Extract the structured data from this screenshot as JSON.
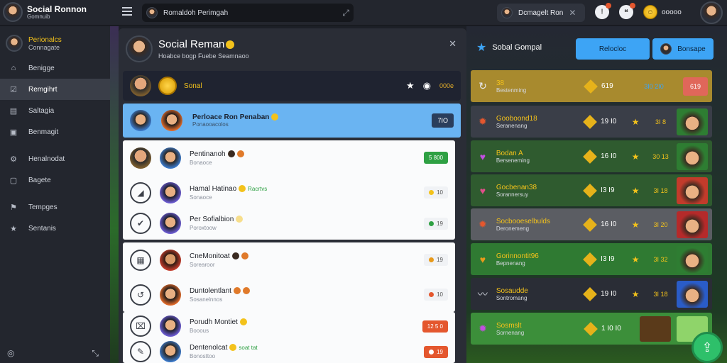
{
  "topbar": {
    "brand_title": "Social Ronnon",
    "brand_sub": "Gomnuib",
    "search_text": "Romaldoh Perimgah",
    "user_chip_name": "Dcmagelt Ron",
    "coins": "ooooo"
  },
  "sidebar": {
    "profile_name": "Perionalcs",
    "profile_sub": "Connagate",
    "items": [
      {
        "label": "Benigge",
        "icon": "home-icon"
      },
      {
        "label": "Remgihrt",
        "icon": "check-square-icon"
      },
      {
        "label": "Saltagia",
        "icon": "chart-icon"
      },
      {
        "label": "Benmagit",
        "icon": "media-icon"
      },
      {
        "label": "Henalnodat",
        "icon": "settings-icon"
      },
      {
        "label": "Bagete",
        "icon": "chat-icon"
      },
      {
        "label": "Tempges",
        "icon": "users-icon"
      },
      {
        "label": "Sentanis",
        "icon": "star-icon"
      }
    ]
  },
  "panel": {
    "title": "Social Reman",
    "subtitle": "Hoabce bogp Fuebe Seamnaoo",
    "dark_row_label": "Sonal",
    "dark_row_count": "000e",
    "highlight": {
      "name": "Perloace Ron Penaban",
      "sub": "Ponaooacolos",
      "badge": "7IO"
    },
    "entries": [
      {
        "name": "Pentinanoh",
        "sub": "Bonaoce",
        "pill": "5 800",
        "pill_style": "green"
      },
      {
        "name": "Hamal Hatinao",
        "tag": "Racrtvs",
        "sub": "Sonaoce",
        "pill": "10",
        "pill_style": "soft"
      },
      {
        "name": "Per Sofialbion",
        "sub": "Poroxtoow",
        "pill": "19",
        "pill_style": "soft"
      },
      {
        "name": "CneMonitoat",
        "sub": "Sorearoor",
        "pill": "19",
        "pill_style": "soft"
      },
      {
        "name": "Duntolentlant",
        "sub": "Sosanelnnos",
        "pill": "10",
        "pill_style": "soft"
      },
      {
        "name": "Porudh Montiet",
        "sub": "Booous",
        "pill": "12 5 0",
        "pill_style": "red"
      },
      {
        "name": "Dentenolcat",
        "tag": "soat tat",
        "sub": "Bonosttoo",
        "pill": "19",
        "pill_style": "soft"
      }
    ]
  },
  "right": {
    "heading": "Sobal Gompal",
    "btn1": "Relocloc",
    "btn2": "Bonsape",
    "rows": [
      {
        "t1": "38",
        "t2": "Bestenming",
        "num": "619",
        "ctr": "3I0 2I0",
        "right": "619",
        "bg": "#a88a2e"
      },
      {
        "t1": "Gooboond18",
        "t2": "Seranenang",
        "num": "19 I0",
        "ctr": "3I 8",
        "bg": "#3a3e48"
      },
      {
        "t1": "Bodan A",
        "t2": "Berseneming",
        "num": "16 I0",
        "ctr": "30 13",
        "bg": "#2f5b2f"
      },
      {
        "t1": "Gocbenan38",
        "t2": "Sorannersuy",
        "num": "I3 I9",
        "ctr": "3I 18",
        "bg": "#2f5b2f"
      },
      {
        "t1": "Socbooeselbulds",
        "t2": "Deronemeng",
        "num": "16 I0",
        "ctr": "3I 20",
        "bg": "#5b5d63"
      },
      {
        "t1": "Gorinnontit96",
        "t2": "Bepnenang",
        "num": "I3 I9",
        "ctr": "3I 32",
        "bg": "#2f7a32"
      },
      {
        "t1": "Sosaudde",
        "t2": "Sontromang",
        "num": "19 I0",
        "ctr": "3I 18",
        "bg": "#2a2d36"
      },
      {
        "t1": "Sosmslt",
        "t2": "Sornenang",
        "num": "1 I0 I0",
        "ctr": "",
        "bg": "#3c8f3a"
      }
    ]
  },
  "colors": {
    "accent": "#3da4f5",
    "gold": "#f3c21b",
    "green": "#2ec06a"
  }
}
